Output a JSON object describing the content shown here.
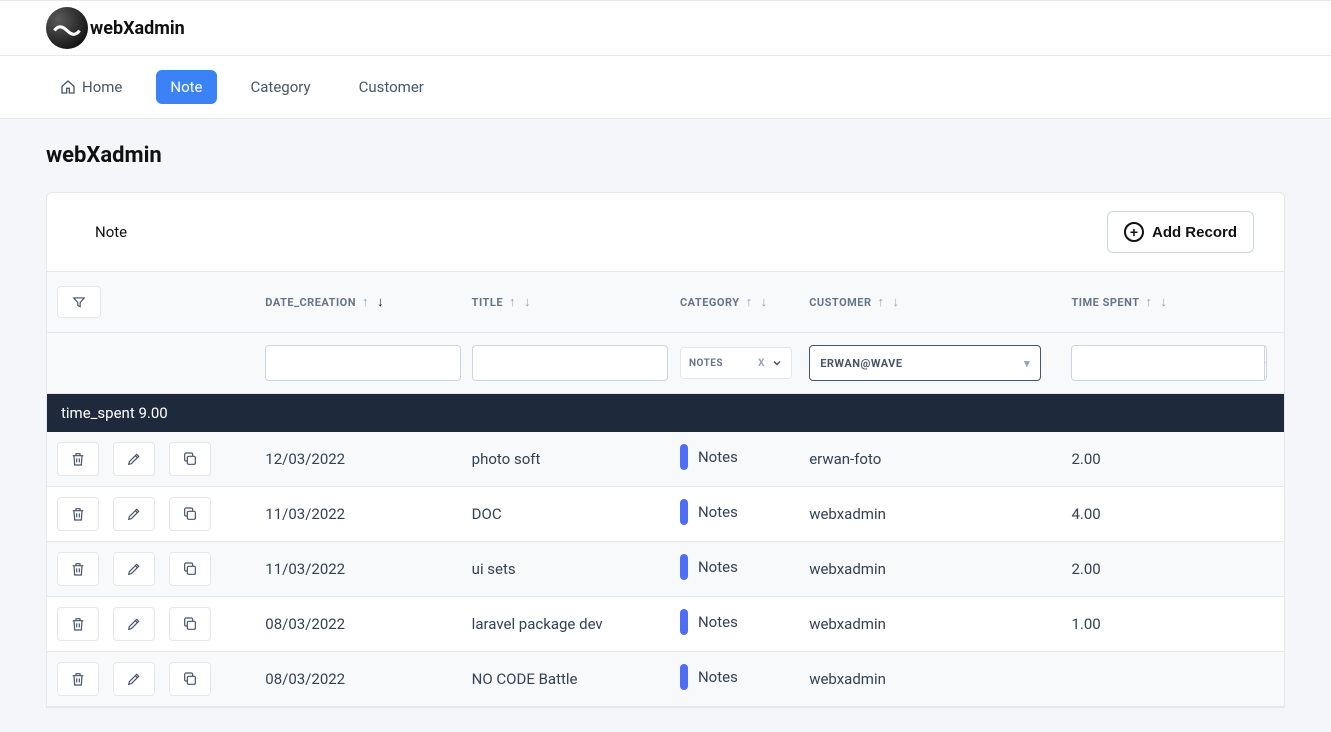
{
  "brand": "webXadmin",
  "nav": {
    "home": "Home",
    "note": "Note",
    "category": "Category",
    "customer": "Customer"
  },
  "page_title": "webXadmin",
  "card": {
    "title": "Note",
    "add_label": "Add Record"
  },
  "columns": {
    "date_creation": "DATE_CREATION",
    "title": "TITLE",
    "category": "CATEGORY",
    "customer": "CUSTOMER",
    "time_spent": "TIME SPENT"
  },
  "filters": {
    "category_tag": "NOTES",
    "customer_value": "ERWAN@WAVE"
  },
  "group_row": "time_spent 9.00",
  "rows": [
    {
      "date": "12/03/2022",
      "title": "photo soft",
      "category": "Notes",
      "customer": "erwan-foto",
      "time": "2.00"
    },
    {
      "date": "11/03/2022",
      "title": "DOC",
      "category": "Notes",
      "customer": "webxadmin",
      "time": "4.00"
    },
    {
      "date": "11/03/2022",
      "title": "ui sets",
      "category": "Notes",
      "customer": "webxadmin",
      "time": "2.00"
    },
    {
      "date": "08/03/2022",
      "title": "laravel package dev",
      "category": "Notes",
      "customer": "webxadmin",
      "time": "1.00"
    },
    {
      "date": "08/03/2022",
      "title": "NO CODE Battle",
      "category": "Notes",
      "customer": "webxadmin",
      "time": ""
    }
  ]
}
